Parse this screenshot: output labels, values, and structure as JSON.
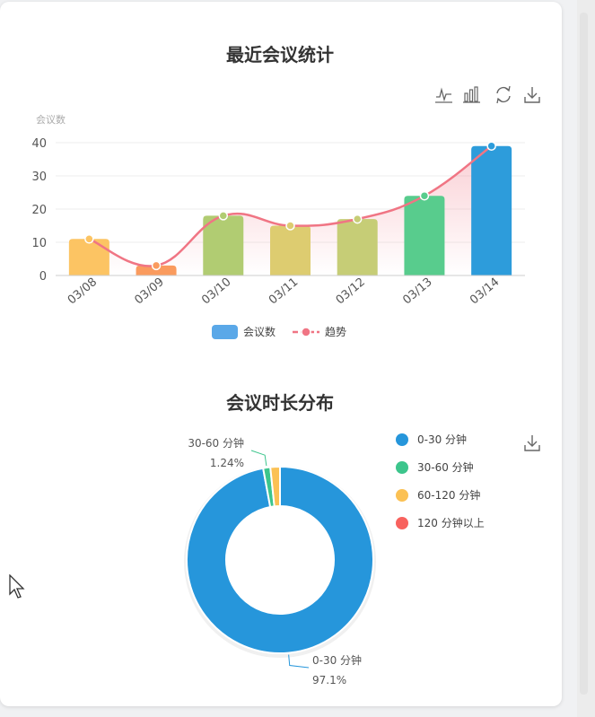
{
  "chart_data": [
    {
      "type": "bar",
      "title": "最近会议统计",
      "ylabel": "会议数",
      "categories": [
        "03/08",
        "03/09",
        "03/10",
        "03/11",
        "03/12",
        "03/13",
        "03/14"
      ],
      "series": [
        {
          "name": "会议数",
          "type": "bar",
          "values": [
            11,
            3,
            18,
            15,
            17,
            24,
            39
          ]
        },
        {
          "name": "趋势",
          "type": "line",
          "smooth": true,
          "values": [
            11,
            3,
            18,
            15,
            17,
            24,
            39
          ]
        }
      ],
      "ylim": [
        0,
        40
      ],
      "yticks": [
        0,
        10,
        20,
        30,
        40
      ],
      "bar_colors": [
        "#fcc463",
        "#fa9b5e",
        "#b1cc72",
        "#ddcc70",
        "#c6cd76",
        "#58cc8d",
        "#2d9cdb"
      ],
      "line_color": "#f07584",
      "grid": true,
      "legend": "bottom-center"
    },
    {
      "type": "pie",
      "title": "会议时长分布",
      "categories": [
        "0-30 分钟",
        "30-60 分钟",
        "60-120 分钟",
        "120 分钟以上"
      ],
      "values": [
        97.1,
        1.24,
        1.66,
        0
      ],
      "value_labels": [
        "97.1%",
        "1.24%",
        "",
        ""
      ],
      "colors": [
        "#2696db",
        "#3cc58c",
        "#fbc154",
        "#f8625e"
      ],
      "legend": "right"
    }
  ],
  "toolbar": {
    "top": [
      "line-chart-icon",
      "bar-chart-icon",
      "refresh-icon",
      "download-icon"
    ],
    "bottom": [
      "download-icon"
    ]
  }
}
